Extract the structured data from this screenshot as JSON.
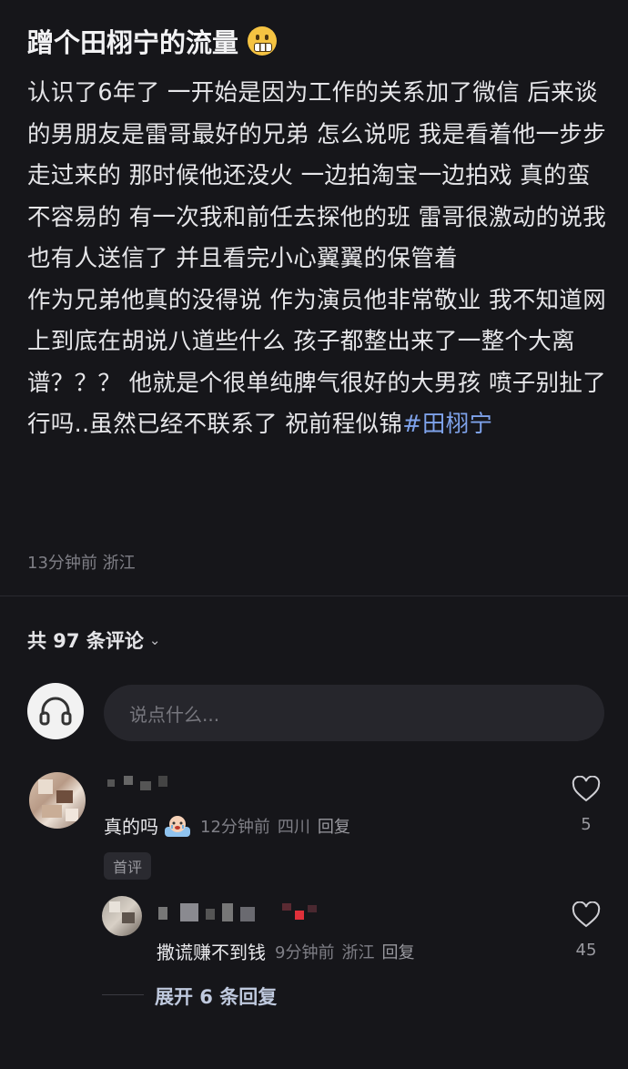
{
  "post": {
    "title": "蹭个田栩宁的流量",
    "title_emoji": "grimacing-face-emoji",
    "paragraph1": "认识了6年了 一开始是因为工作的关系加了微信 后来谈的男朋友是雷哥最好的兄弟 怎么说呢 我是看着他一步步走过来的 那时候他还没火 一边拍淘宝一边拍戏 真的蛮不容易的 有一次我和前任去探他的班 雷哥很激动的说我也有人送信了 并且看完小心翼翼的保管着",
    "paragraph2": "作为兄弟他真的没得说 作为演员他非常敬业 我不知道网上到底在胡说八道些什么 孩子都整出来了一整个大离谱？？？ 他就是个很单纯脾气很好的大男孩 喷子别扯了行吗..虽然已经不联系了 祝前程似锦",
    "hashtag": "#田栩宁",
    "time": "13分钟前",
    "location": "浙江"
  },
  "comments_header": {
    "label": "共 97 条评论"
  },
  "comment_input": {
    "placeholder": "说点什么..."
  },
  "comments": [
    {
      "text": "真的吗",
      "emoji": "crying-baby-emoji",
      "time": "12分钟前",
      "location": "四川",
      "reply_label": "回复",
      "likes": "5",
      "badge": "首评"
    }
  ],
  "replies": [
    {
      "text": "撒谎赚不到钱",
      "time": "9分钟前",
      "location": "浙江",
      "reply_label": "回复",
      "likes": "45"
    }
  ],
  "expand_replies": {
    "label": "展开 6 条回复"
  },
  "colors": {
    "background": "#16161a",
    "hashtag": "#7ea2ea",
    "meta": "#7f7f86"
  }
}
